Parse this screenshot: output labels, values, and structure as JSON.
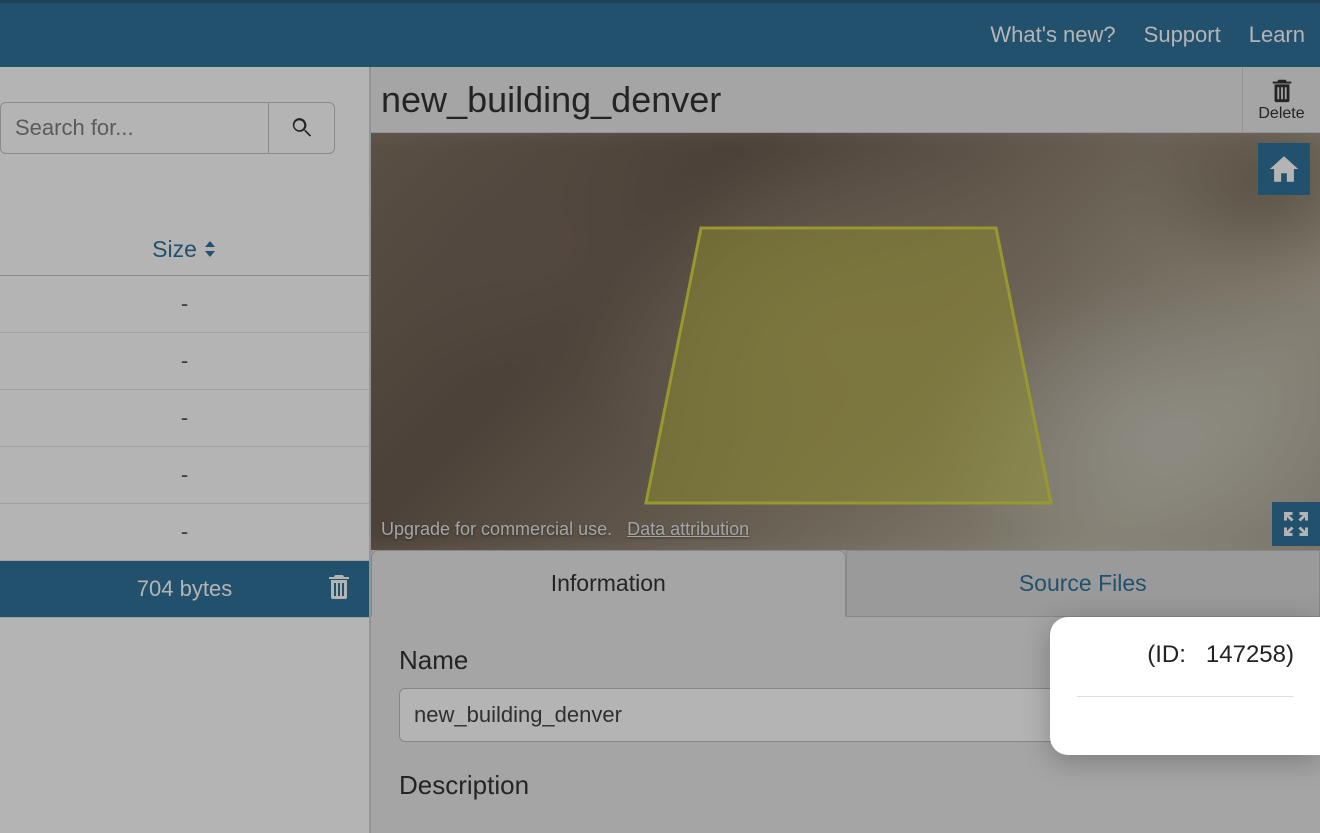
{
  "topnav": {
    "whatsnew": "What's new?",
    "support": "Support",
    "learn": "Learn"
  },
  "search": {
    "placeholder": "Search for..."
  },
  "table": {
    "size_header": "Size",
    "rows": [
      {
        "size": "-"
      },
      {
        "size": "-"
      },
      {
        "size": "-"
      },
      {
        "size": "-"
      },
      {
        "size": "-"
      },
      {
        "size": "704 bytes",
        "selected": true
      }
    ]
  },
  "detail": {
    "title": "new_building_denver",
    "delete_label": "Delete",
    "attribution_text": "Upgrade for commercial use.",
    "attribution_link": "Data attribution",
    "tabs": {
      "information": "Information",
      "source_files": "Source Files"
    },
    "form": {
      "name_label": "Name",
      "name_value": "new_building_denver",
      "description_label": "Description"
    }
  },
  "popup": {
    "id_prefix": "(ID:",
    "id_value": "147258)",
    "combined": "(ID:   147258)"
  }
}
